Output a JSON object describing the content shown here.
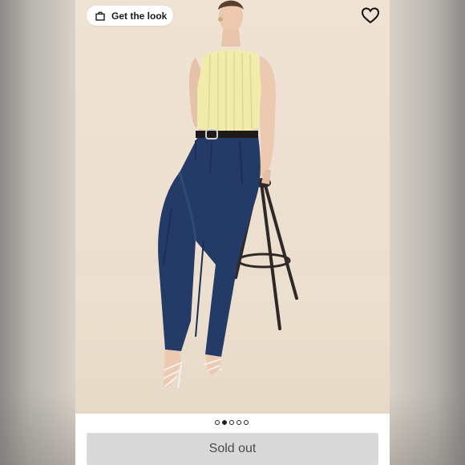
{
  "look_button": {
    "label": "Get the look",
    "icon": "shopping-bag-icon"
  },
  "favorite": {
    "icon": "heart-icon"
  },
  "product_image": {
    "alt": ""
  },
  "pagination": {
    "count": 5,
    "active_index": 1
  },
  "buy_button": {
    "label": "Sold out"
  },
  "colors": {
    "backdrop": "#ecdfcf",
    "button_disabled": "#d9d9d9",
    "button_text": "#4a4a4a",
    "top": "#f2ecaa",
    "denim": "#233b66"
  }
}
